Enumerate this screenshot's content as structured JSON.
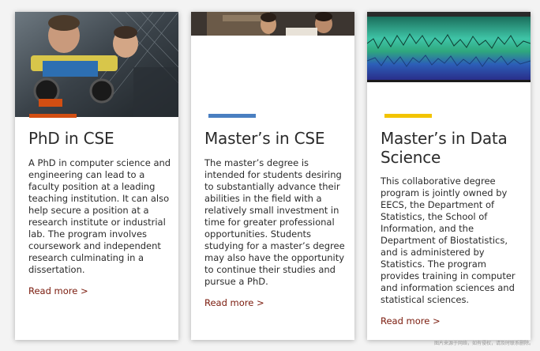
{
  "colors": {
    "accent_phd": "#d24e12",
    "accent_masters": "#4a7fc1",
    "accent_ds": "#f2c400",
    "link": "#7a1a0c"
  },
  "cards": [
    {
      "title": "PhD in CSE",
      "text": "A PhD in computer science and engineering can lead to a faculty position at a leading teaching institution. It can also help secure a position at a research institute or industrial lab. The program involves coursework and independent research culminating in a dissertation.",
      "link": "Read more >"
    },
    {
      "title": "Master’s in CSE",
      "text": "The master’s degree is intended for students desiring to substantially advance their abilities in the field with a relatively small investment in time for greater professional opportunities. Students studying for a master’s degree may also have the opportunity to continue their studies and pursue a PhD.",
      "link": "Read more >"
    },
    {
      "title": "Master’s in Data Science",
      "text": "This collaborative degree program is jointly owned by EECS, the Department of Statistics, the School of Information, and the Department of Biostatistics, and is administered by Statistics. The program provides training in computer and information sciences and statistical sciences.",
      "link": "Read more >"
    }
  ],
  "watermark": "图片来源于网络，如有侵权，请及时联系删除。"
}
